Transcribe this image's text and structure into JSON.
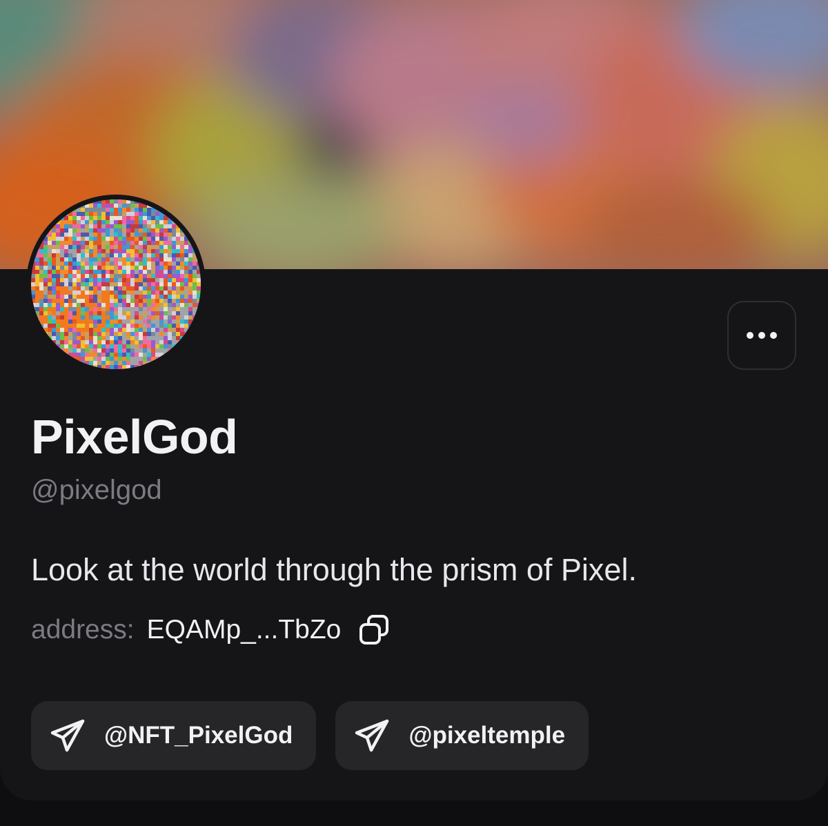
{
  "profile": {
    "display_name": "PixelGod",
    "handle": "@pixelgod",
    "bio": "Look at the world through the prism of Pixel.",
    "address_label": "address:",
    "address_value": "EQAMp_...TbZo"
  },
  "actions": {
    "more_icon": "more-horizontal-icon",
    "copy_icon": "copy-icon"
  },
  "links": [
    {
      "icon": "telegram-icon",
      "label": "@NFT_PixelGod"
    },
    {
      "icon": "telegram-icon",
      "label": "@pixeltemple"
    }
  ],
  "colors": {
    "background": "#0e0e10",
    "card": "#151517",
    "chip": "#262629",
    "primary_text": "#f2f2f4",
    "secondary_text": "#7b7b83"
  }
}
